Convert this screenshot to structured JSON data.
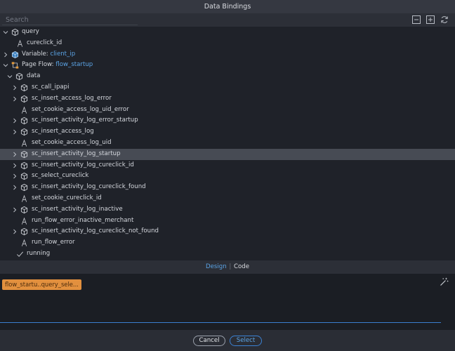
{
  "title": "Data Bindings",
  "search": {
    "placeholder": "Search"
  },
  "toolbar": {
    "icons": [
      "collapse-all-icon",
      "expand-all-icon",
      "refresh-icon"
    ]
  },
  "tree": {
    "query": {
      "label": "query",
      "children": [
        "cureclick_id"
      ]
    },
    "variable": {
      "prefix": "Variable:",
      "name": "client_ip"
    },
    "page_flow": {
      "prefix": "Page Flow:",
      "name": "flow_startup"
    },
    "data": {
      "label": "data",
      "items": [
        {
          "label": "sc_call_ipapi",
          "type": "object"
        },
        {
          "label": "sc_insert_access_log_error",
          "type": "object"
        },
        {
          "label": "set_cookie_access_log_uid_error",
          "type": "text"
        },
        {
          "label": "sc_insert_activity_log_error_startup",
          "type": "object"
        },
        {
          "label": "sc_insert_access_log",
          "type": "object"
        },
        {
          "label": "set_cookie_access_log_uid",
          "type": "text"
        },
        {
          "label": "sc_insert_activity_log_startup",
          "type": "object",
          "selected": true
        },
        {
          "label": "sc_insert_activity_log_cureclick_id",
          "type": "object"
        },
        {
          "label": "sc_select_cureclick",
          "type": "object"
        },
        {
          "label": "sc_insert_activity_log_cureclick_found",
          "type": "object"
        },
        {
          "label": "set_cookie_cureclick_id",
          "type": "text"
        },
        {
          "label": "sc_insert_activity_log_inactive",
          "type": "object"
        },
        {
          "label": "run_flow_error_inactive_merchant",
          "type": "text"
        },
        {
          "label": "sc_insert_activity_log_cureclick_not_found",
          "type": "object"
        },
        {
          "label": "run_flow_error",
          "type": "text"
        }
      ]
    },
    "running": {
      "label": "running"
    }
  },
  "tabs": {
    "design": "Design",
    "code": "Code"
  },
  "editor": {
    "expression": "flow_startu..query_sele..."
  },
  "footer": {
    "cancel": "Cancel",
    "select": "Select"
  }
}
